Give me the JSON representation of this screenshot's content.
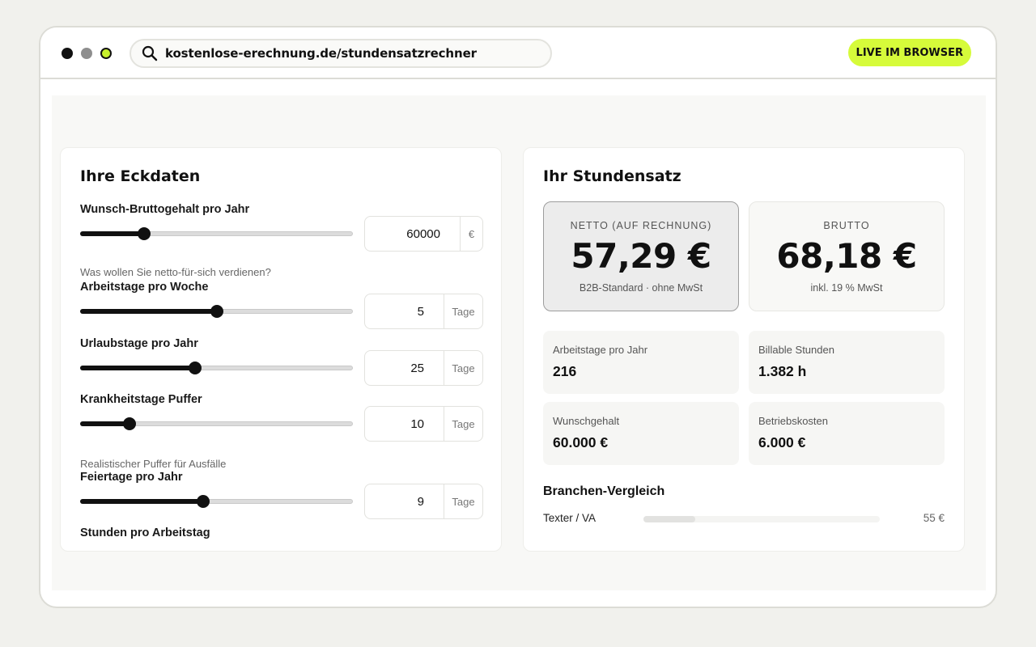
{
  "browser": {
    "url": "kostenlose-erechnung.de/stundensatzrechner",
    "badge": "LIVE IM BROWSER",
    "accent_color": "#d6fb3a"
  },
  "inputs": {
    "title": "Ihre Eckdaten",
    "salary": {
      "label": "Wunsch-Bruttogehalt pro Jahr",
      "value": "60000",
      "unit": "€",
      "hint": "Was wollen Sie netto-für-sich verdienen?",
      "slider_fraction": 0.235
    },
    "workdays": {
      "label": "Arbeitstage pro Woche",
      "value": "5",
      "unit": "Tage",
      "slider_fraction": 0.5
    },
    "vacation": {
      "label": "Urlaubstage pro Jahr",
      "value": "25",
      "unit": "Tage",
      "slider_fraction": 0.42
    },
    "sick": {
      "label": "Krankheitstage Puffer",
      "value": "10",
      "unit": "Tage",
      "hint": "Realistischer Puffer für Ausfälle",
      "slider_fraction": 0.18
    },
    "holidays": {
      "label": "Feiertage pro Jahr",
      "value": "9",
      "unit": "Tage",
      "slider_fraction": 0.45
    },
    "hours": {
      "label": "Stunden pro Arbeitstag"
    }
  },
  "results": {
    "title": "Ihr Stundensatz",
    "netto": {
      "label": "NETTO (AUF RECHNUNG)",
      "value": "57,29 €",
      "sub": "B2B-Standard · ohne MwSt"
    },
    "brutto": {
      "label": "BRUTTO",
      "value": "68,18 €",
      "sub": "inkl. 19 % MwSt"
    },
    "stats": [
      {
        "label": "Arbeitstage pro Jahr",
        "value": "216"
      },
      {
        "label": "Billable Stunden",
        "value": "1.382 h"
      },
      {
        "label": "Wunschgehalt",
        "value": "60.000 €"
      },
      {
        "label": "Betriebskosten",
        "value": "6.000 €"
      }
    ],
    "branch_title": "Branchen-Vergleich",
    "branches": [
      {
        "name": "Texter / VA",
        "value": "55 €",
        "fraction": 0.22
      }
    ]
  }
}
